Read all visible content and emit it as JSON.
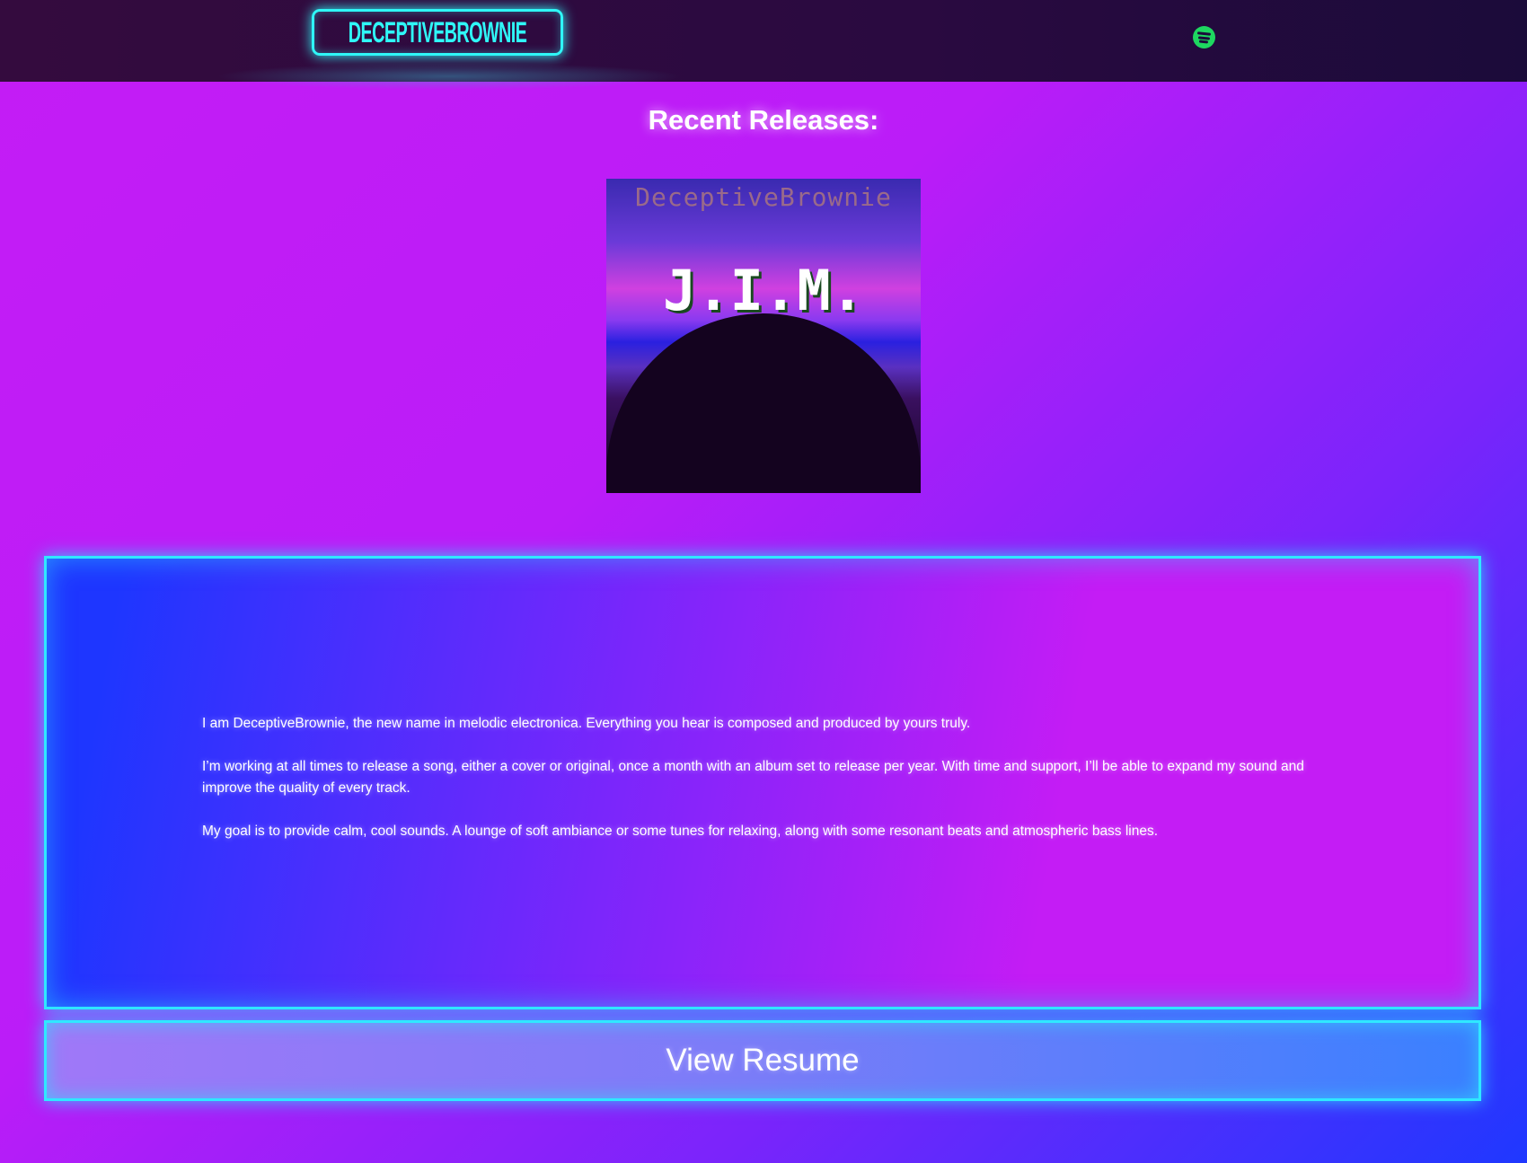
{
  "header": {
    "logo_text": "DECEPTIVEBROWNIE",
    "social_icons": [
      {
        "name": "spotify-icon",
        "color": "#1ed760"
      }
    ]
  },
  "releases": {
    "title": "Recent Releases:",
    "cover": {
      "artist": "DeceptiveBrownie",
      "album": "J.I.M."
    }
  },
  "about": {
    "paragraphs": [
      "I am DeceptiveBrownie, the new name in melodic electronica. Everything you hear is composed and produced by yours truly.",
      "I’m working at all times to release a song, either a cover or original, once a month with an album set to release per year. With time and support, I’ll be able to expand my sound and improve the quality of every track.",
      "My goal is to provide calm, cool sounds. A lounge of soft ambiance or some tunes for relaxing, along with some resonant beats and atmospheric bass lines."
    ]
  },
  "resume_button": {
    "label": "View Resume"
  },
  "colors": {
    "accent": "#2ff7f7",
    "header_bg": "#2a0a40",
    "bg_magenta": "#c41cf5",
    "bg_blue": "#1f38ff"
  }
}
